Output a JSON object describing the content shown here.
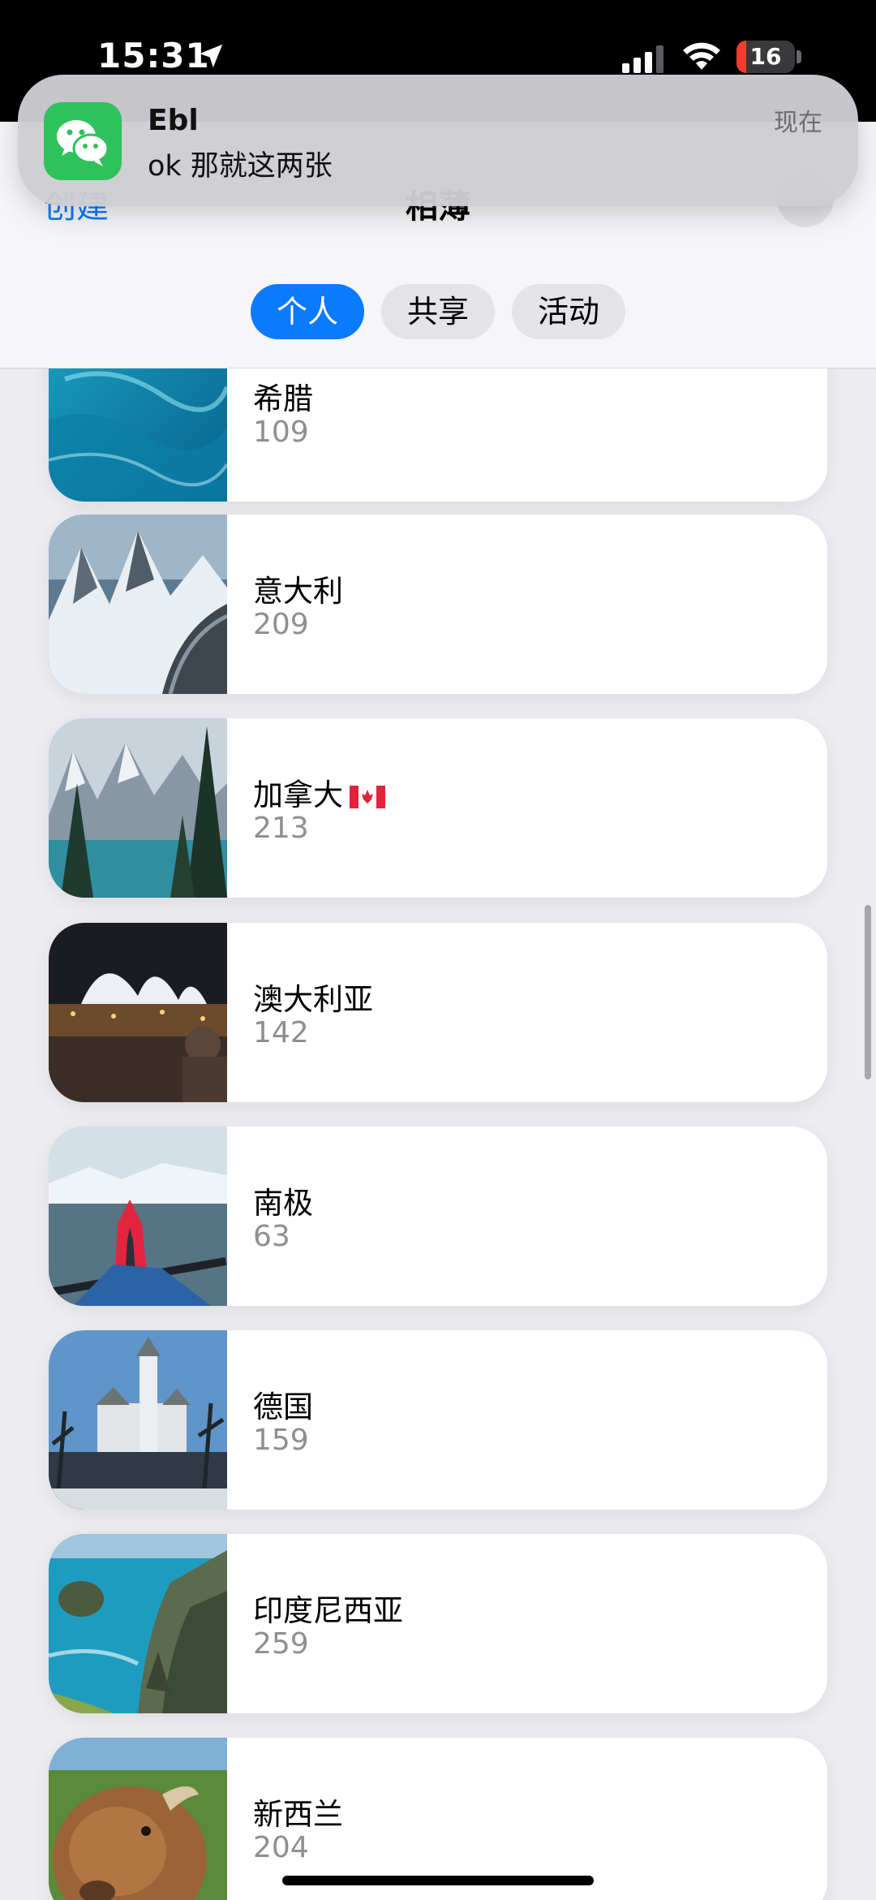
{
  "status_bar": {
    "time": "15:31",
    "battery": "16",
    "battery_level_percent": 16
  },
  "header": {
    "left_action": "创建",
    "title": "相薄"
  },
  "segments": [
    {
      "label": "个人",
      "active": true
    },
    {
      "label": "共享",
      "active": false
    },
    {
      "label": "活动",
      "active": false
    }
  ],
  "albums": [
    {
      "name": "希腊",
      "count": "109"
    },
    {
      "name": "意大利",
      "count": "209"
    },
    {
      "name": "加拿大",
      "count": "213"
    },
    {
      "name": "澳大利亚",
      "count": "142"
    },
    {
      "name": "南极",
      "count": "63"
    },
    {
      "name": "德国",
      "count": "159"
    },
    {
      "name": "印度尼西亚",
      "count": "259"
    },
    {
      "name": "新西兰",
      "count": "204"
    }
  ],
  "notification": {
    "app_icon": "wechat-icon",
    "sender": "Ebl",
    "message": "ok 那就这两张",
    "time": "现在"
  },
  "colors": {
    "accent": "#0a7aff",
    "wechat": "#2dc25b",
    "battery_low": "#ff3b30"
  }
}
